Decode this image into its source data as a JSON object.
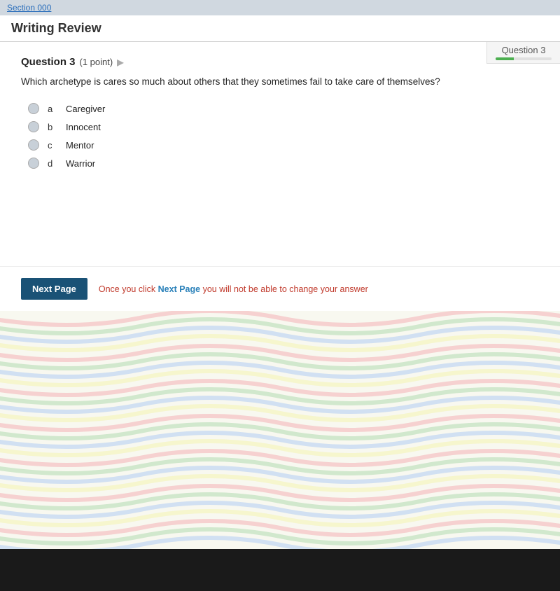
{
  "topBar": {
    "text": "Section 000"
  },
  "pageHeader": {
    "title": "Writing Review"
  },
  "questionIndicator": {
    "label": "Question 3"
  },
  "question": {
    "number": "Question 3",
    "points": "(1 point)",
    "text": "Which archetype is cares so much about others that they sometimes fail to take care of themselves?",
    "options": [
      {
        "letter": "a",
        "text": "Caregiver"
      },
      {
        "letter": "b",
        "text": "Innocent"
      },
      {
        "letter": "c",
        "text": "Mentor"
      },
      {
        "letter": "d",
        "text": "Warrior"
      }
    ]
  },
  "nextPage": {
    "button_label": "Next Page",
    "warning_prefix": "Once you click ",
    "warning_link": "Next Page",
    "warning_suffix": " you will not be able to change your answer"
  }
}
